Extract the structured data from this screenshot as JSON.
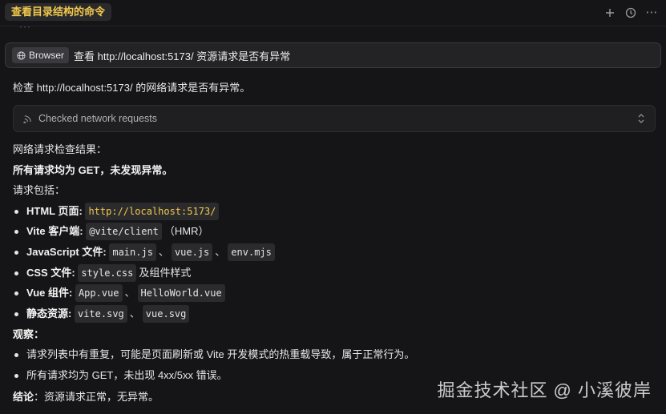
{
  "header": {
    "title": "查看目录结构的命令",
    "actions": [
      {
        "icon": "plus-icon"
      },
      {
        "icon": "history-icon"
      },
      {
        "icon": "more-icon",
        "glyph": "⋯"
      }
    ]
  },
  "ellipsis": "···",
  "query": {
    "chip_icon": "globe-icon",
    "chip_label": "Browser",
    "text": "查看 http://localhost:5173/ 资源请求是否有异常"
  },
  "intro": "检查 http://localhost:5173/ 的网络请求是否有异常。",
  "tool_call": {
    "icon": "network-icon",
    "label": "Checked network requests",
    "expand_icon": "chevron-updown-icon"
  },
  "result_heading": "网络请求检查结果：",
  "summary": "所有请求均为 GET，未发现异常。",
  "includes_label": "请求包括：",
  "requests": {
    "html": {
      "label": "HTML 页面",
      "colon": ":",
      "code": "http://localhost:5173/"
    },
    "vite": {
      "label": "Vite 客户端",
      "colon": ":",
      "code": "@vite/client",
      "suffix": "（HMR）"
    },
    "js": {
      "label": "JavaScript 文件",
      "colon": ":",
      "codes": [
        "main.js",
        "vue.js",
        "env.mjs"
      ],
      "sep": "、"
    },
    "css": {
      "label": "CSS 文件",
      "colon": ":",
      "code": "style.css",
      "suffix": "及组件样式"
    },
    "vue": {
      "label": "Vue 组件",
      "colon": ":",
      "codes": [
        "App.vue",
        "HelloWorld.vue"
      ],
      "sep": "、"
    },
    "static": {
      "label": "静态资源",
      "colon": ":",
      "codes": [
        "vite.svg",
        "vue.svg"
      ],
      "sep": "、"
    }
  },
  "observe_label": "观察：",
  "observations": [
    "请求列表中有重复，可能是页面刷新或 Vite 开发模式的热重载导致，属于正常行为。",
    "所有请求均为 GET，未出现 4xx/5xx 错误。"
  ],
  "conclusion": {
    "label": "结论",
    "text": "：资源请求正常，无异常。"
  },
  "watermark": "掘金技术社区 @ 小溪彼岸"
}
